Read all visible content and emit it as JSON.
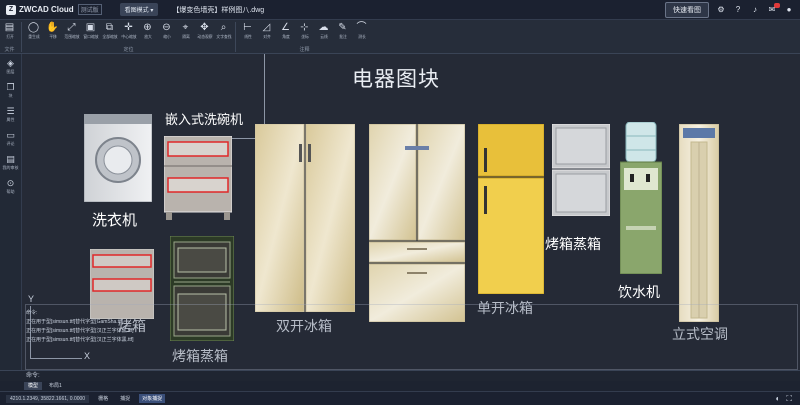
{
  "titlebar": {
    "app_name": "ZWCAD Cloud",
    "edition_tag": "测试版",
    "mode_label": "看图模式 ▾",
    "document_title": "【爆变色墙壳】样例图八.dwg",
    "quick_view_label": "快速看图"
  },
  "ribbon": {
    "groups": [
      {
        "label": "文件",
        "items": [
          {
            "icon": "open-icon",
            "label": "打开"
          }
        ]
      },
      {
        "label": "定位",
        "items": [
          {
            "icon": "redraw-icon",
            "label": "重生成"
          },
          {
            "icon": "pan-icon",
            "label": "平移"
          },
          {
            "icon": "zoom-extents-icon",
            "label": "范围缩放"
          },
          {
            "icon": "zoom-window-icon",
            "label": "窗口缩放"
          },
          {
            "icon": "zoom-all-icon",
            "label": "全部缩放"
          },
          {
            "icon": "zoom-center-icon",
            "label": "中心缩放"
          },
          {
            "icon": "zoom-in-icon",
            "label": "放大"
          },
          {
            "icon": "zoom-out-icon",
            "label": "缩小"
          },
          {
            "icon": "isolate-icon",
            "label": "隔离"
          },
          {
            "icon": "dynamic-pan-icon",
            "label": "动态观察"
          },
          {
            "icon": "text-search-icon",
            "label": "文字查找"
          }
        ]
      },
      {
        "label": "注释",
        "items": [
          {
            "icon": "linear-dim-icon",
            "label": "线性"
          },
          {
            "icon": "aligned-dim-icon",
            "label": "对齐"
          },
          {
            "icon": "angle-dim-icon",
            "label": "角度"
          },
          {
            "icon": "coordinate-icon",
            "label": "坐标"
          },
          {
            "icon": "leader-icon",
            "label": "云线"
          },
          {
            "icon": "markup-icon",
            "label": "批注"
          },
          {
            "icon": "tape-icon",
            "label": "测长"
          }
        ]
      }
    ]
  },
  "sidebar": {
    "items": [
      {
        "icon": "layers-icon",
        "label": "图层"
      },
      {
        "icon": "blocks-icon",
        "label": "块"
      },
      {
        "icon": "properties-icon",
        "label": "属性"
      },
      {
        "icon": "comments-icon",
        "label": "评论"
      },
      {
        "icon": "review-icon",
        "label": "我的审核"
      },
      {
        "icon": "help-icon",
        "label": "帮助"
      }
    ]
  },
  "canvas": {
    "title": "电器图块",
    "labels": {
      "washing_machine": "洗衣机",
      "dishwasher": "嵌入式洗碗机",
      "oven_steamer_left": "烤箱",
      "oven_steamer_left2": "烤箱蒸箱",
      "double_fridge": "双开冰箱",
      "single_fridge": "单开冰箱",
      "oven_steamer_right": "烤箱蒸箱",
      "water_dispenser": "饮水机",
      "standing_ac": "立式空调"
    },
    "command_log": [
      "命令:",
      "正在用于型[simsun.ttf]替代字型[GamSha.ttf]",
      "正在用于型[simsun.ttf]替代字型[汉正兰字体黑.ttf]",
      "正在用于型[simsun.ttf]替代字型[汉正兰字体黑.ttf]"
    ],
    "axis_x": "X",
    "axis_y": "Y"
  },
  "cmdbar": {
    "prompt": "命令:"
  },
  "layout_tabs": [
    {
      "label": "模型",
      "active": true
    },
    {
      "label": "布局1",
      "active": false
    }
  ],
  "statusbar": {
    "coords": "4210.1.2349,   35822.1661,   0.0000",
    "toggles": [
      {
        "label": "栅格",
        "on": false
      },
      {
        "label": "捕捉",
        "on": false
      },
      {
        "label": "对象捕捉",
        "on": true
      }
    ]
  },
  "colors": {
    "canvas_bg": "#252a36",
    "accent_red": "#e02828",
    "fridge_gold": "#e6c13a"
  }
}
